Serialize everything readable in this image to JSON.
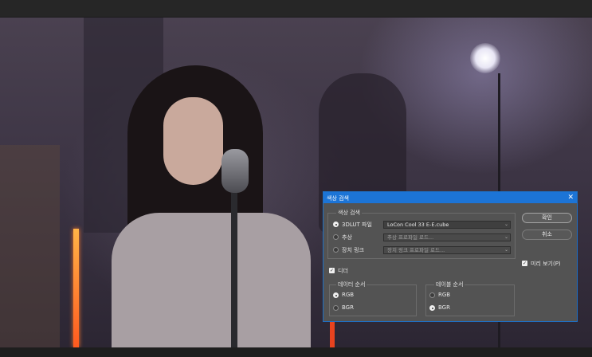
{
  "dialog": {
    "title": "색상 검색",
    "close_glyph": "✕",
    "group_label": "색상 검색",
    "options": [
      {
        "label": "3DLUT 파일",
        "selected": true,
        "value": "LoCon Cool 33 E-E.cube",
        "enabled": true
      },
      {
        "label": "추상",
        "selected": false,
        "value": "추상 프로파일 로드...",
        "enabled": false
      },
      {
        "label": "장치 링크",
        "selected": false,
        "value": "장치 링크 프로파일 로드...",
        "enabled": false
      }
    ],
    "ok_label": "확인",
    "cancel_label": "취소",
    "preview_label": "미리 보기(P)",
    "preview_checked": true,
    "dither_label": "디더",
    "dither_checked": true,
    "data_order": {
      "label": "데이터 순서",
      "options": [
        {
          "label": "RGB",
          "selected": true
        },
        {
          "label": "BGR",
          "selected": false
        }
      ]
    },
    "table_order": {
      "label": "테이블 순서",
      "options": [
        {
          "label": "RGB",
          "selected": false
        },
        {
          "label": "BGR",
          "selected": true
        }
      ]
    },
    "chevron_glyph": "⌄",
    "check_glyph": "✓"
  },
  "colors": {
    "accent": "#1c74d6",
    "dialog_bg": "#535353"
  }
}
